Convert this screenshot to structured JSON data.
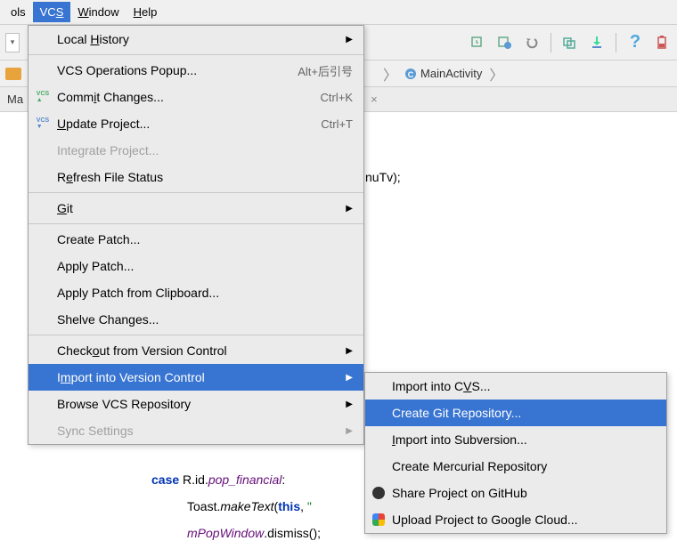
{
  "menubar": {
    "tools": "ols",
    "vcs": "VCS",
    "window": "Window",
    "help": "Help"
  },
  "breadcrumb": {
    "item": "MainActivity"
  },
  "tabs": {
    "label": "Ma",
    "close": "×"
  },
  "code": {
    "line1": "nuTv);",
    "case": "case",
    "rid": " R.id.",
    "popfin": "pop_financial",
    "colon": ":",
    "toast": "Toast.",
    "maketext": "makeText",
    "paren_this": "(",
    "kw_this": "this",
    "after_this": ", \"",
    "mpop": "mPopWindow",
    "dismiss": ".dismiss();"
  },
  "menu": {
    "localHistory": "Local History",
    "vcsPopup": "VCS Operations Popup...",
    "vcsPopupSc": "Alt+后引号",
    "commit": "Commit Changes...",
    "commitSc": "Ctrl+K",
    "update": "Update Project...",
    "updateSc": "Ctrl+T",
    "integrate": "Integrate Project...",
    "refresh": "Refresh File Status",
    "git": "Git",
    "createPatch": "Create Patch...",
    "applyPatch": "Apply Patch...",
    "applyPatchClip": "Apply Patch from Clipboard...",
    "shelve": "Shelve Changes...",
    "checkout": "Checkout from Version Control",
    "import": "Import into Version Control",
    "browse": "Browse VCS Repository",
    "sync": "Sync Settings"
  },
  "submenu": {
    "cvs": "Import into CVS...",
    "git": "Create Git Repository...",
    "svn": "Import into Subversion...",
    "hg": "Create Mercurial Repository",
    "github": "Share Project on GitHub",
    "gcloud": "Upload Project to Google Cloud..."
  },
  "arrow": "▶"
}
